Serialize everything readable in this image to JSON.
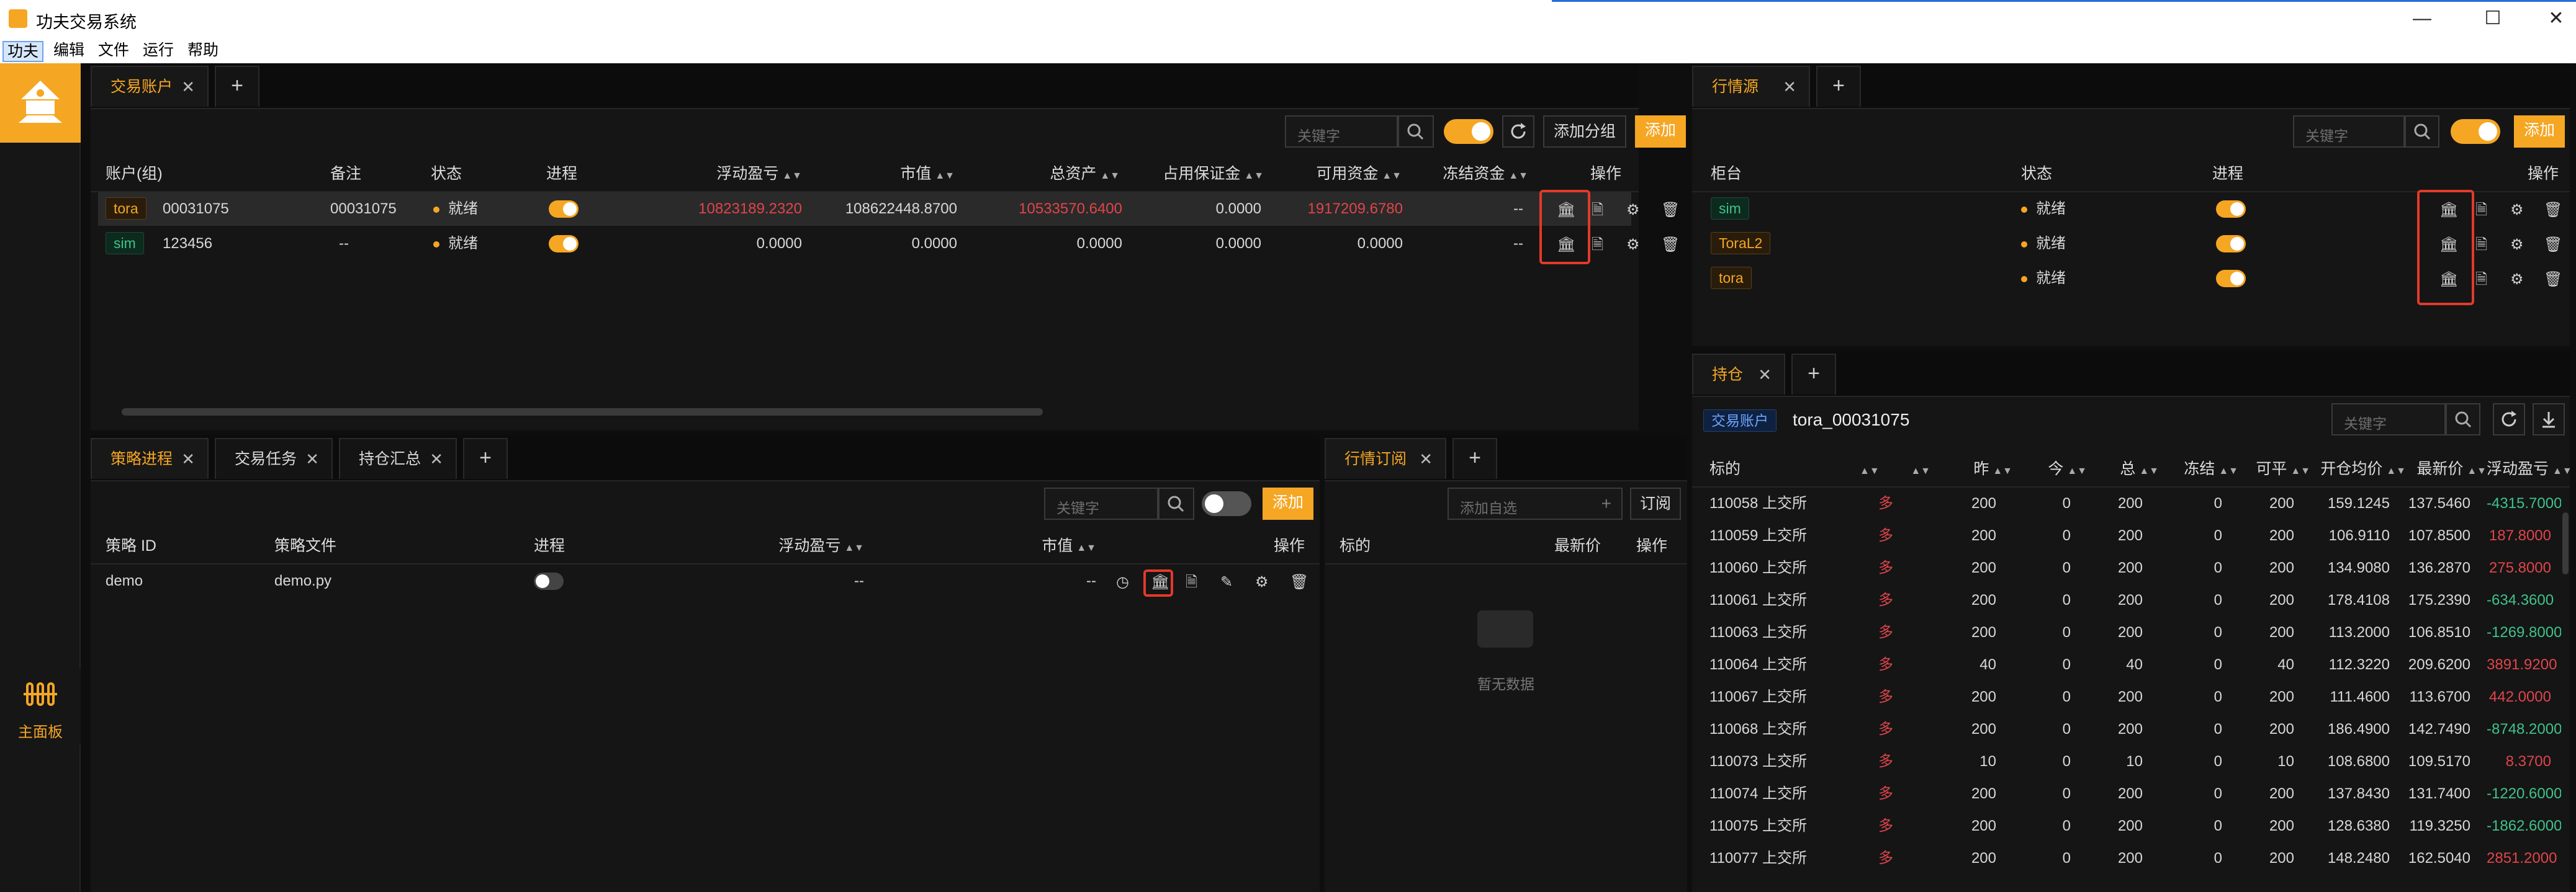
{
  "window": {
    "title": "功夫交易系统",
    "minimize": "—",
    "maximize": "☐",
    "close": "✕"
  },
  "menu": [
    "功夫",
    "编辑",
    "文件",
    "运行",
    "帮助"
  ],
  "sidebar": {
    "main_panel_label": "主面板",
    "main_panel_icon": "0|0|0"
  },
  "accounts_panel": {
    "tabs": [
      {
        "label": "交易账户"
      }
    ],
    "search_placeholder": "关键字",
    "add_group_label": "添加分组",
    "add_label": "添加",
    "columns": [
      "账户(组)",
      "备注",
      "状态",
      "进程",
      "浮动盈亏",
      "市值",
      "总资产",
      "占用保证金",
      "可用资金",
      "冻结资金",
      "操作"
    ],
    "rows": [
      {
        "badge": "tora",
        "account": "00031075",
        "note": "00031075",
        "status": "就绪",
        "pnl": "10823189.2320",
        "market_value": "108622448.8700",
        "total_assets": "10533570.6400",
        "margin": "0.0000",
        "available": "1917209.6780",
        "frozen": "--"
      },
      {
        "badge": "sim",
        "account": "123456",
        "note": "--",
        "status": "就绪",
        "pnl": "0.0000",
        "market_value": "0.0000",
        "total_assets": "0.0000",
        "margin": "0.0000",
        "available": "0.0000",
        "frozen": "--"
      }
    ]
  },
  "md_panel": {
    "tabs": [
      {
        "label": "行情源"
      }
    ],
    "search_placeholder": "关键字",
    "add_label": "添加",
    "columns": [
      "柜台",
      "状态",
      "进程",
      "操作"
    ],
    "rows": [
      {
        "badge": "sim",
        "status": "就绪"
      },
      {
        "badge": "ToraL2",
        "status": "就绪"
      },
      {
        "badge": "tora",
        "status": "就绪"
      }
    ]
  },
  "strategy_panel": {
    "tabs": [
      {
        "label": "策略进程"
      },
      {
        "label": "交易任务"
      },
      {
        "label": "持仓汇总"
      }
    ],
    "search_placeholder": "关键字",
    "add_label": "添加",
    "columns": [
      "策略 ID",
      "策略文件",
      "进程",
      "浮动盈亏",
      "市值",
      "操作"
    ],
    "rows": [
      {
        "id": "demo",
        "file": "demo.py",
        "pnl": "--",
        "market_value": "--"
      }
    ]
  },
  "subscribe_panel": {
    "tabs": [
      {
        "label": "行情订阅"
      }
    ],
    "input_placeholder": "添加自选",
    "subscribe_label": "订阅",
    "columns": [
      "标的",
      "最新价",
      "操作"
    ],
    "empty_text": "暂无数据"
  },
  "position_panel": {
    "tabs": [
      {
        "label": "持仓"
      }
    ],
    "account_tag": "交易账户",
    "account_name": "tora_00031075",
    "search_placeholder": "关键字",
    "columns": [
      "标的",
      "",
      "昨",
      "今",
      "总",
      "冻结",
      "可平",
      "开仓均价",
      "最新价",
      "浮动盈亏"
    ],
    "rows": [
      {
        "code": "110058 上交所",
        "dir": "多",
        "y": "200",
        "t": "0",
        "total": "200",
        "frozen": "0",
        "avail": "200",
        "open": "159.1245",
        "last": "137.5460",
        "pnl": "-4315.7000"
      },
      {
        "code": "110059 上交所",
        "dir": "多",
        "y": "200",
        "t": "0",
        "total": "200",
        "frozen": "0",
        "avail": "200",
        "open": "106.9110",
        "last": "107.8500",
        "pnl": "187.8000"
      },
      {
        "code": "110060 上交所",
        "dir": "多",
        "y": "200",
        "t": "0",
        "total": "200",
        "frozen": "0",
        "avail": "200",
        "open": "134.9080",
        "last": "136.2870",
        "pnl": "275.8000"
      },
      {
        "code": "110061 上交所",
        "dir": "多",
        "y": "200",
        "t": "0",
        "total": "200",
        "frozen": "0",
        "avail": "200",
        "open": "178.4108",
        "last": "175.2390",
        "pnl": "-634.3600"
      },
      {
        "code": "110063 上交所",
        "dir": "多",
        "y": "200",
        "t": "0",
        "total": "200",
        "frozen": "0",
        "avail": "200",
        "open": "113.2000",
        "last": "106.8510",
        "pnl": "-1269.8000"
      },
      {
        "code": "110064 上交所",
        "dir": "多",
        "y": "40",
        "t": "0",
        "total": "40",
        "frozen": "0",
        "avail": "40",
        "open": "112.3220",
        "last": "209.6200",
        "pnl": "3891.9200"
      },
      {
        "code": "110067 上交所",
        "dir": "多",
        "y": "200",
        "t": "0",
        "total": "200",
        "frozen": "0",
        "avail": "200",
        "open": "111.4600",
        "last": "113.6700",
        "pnl": "442.0000"
      },
      {
        "code": "110068 上交所",
        "dir": "多",
        "y": "200",
        "t": "0",
        "total": "200",
        "frozen": "0",
        "avail": "200",
        "open": "186.4900",
        "last": "142.7490",
        "pnl": "-8748.2000"
      },
      {
        "code": "110073 上交所",
        "dir": "多",
        "y": "10",
        "t": "0",
        "total": "10",
        "frozen": "0",
        "avail": "10",
        "open": "108.6800",
        "last": "109.5170",
        "pnl": "8.3700"
      },
      {
        "code": "110074 上交所",
        "dir": "多",
        "y": "200",
        "t": "0",
        "total": "200",
        "frozen": "0",
        "avail": "200",
        "open": "137.8430",
        "last": "131.7400",
        "pnl": "-1220.6000"
      },
      {
        "code": "110075 上交所",
        "dir": "多",
        "y": "200",
        "t": "0",
        "total": "200",
        "frozen": "0",
        "avail": "200",
        "open": "128.6380",
        "last": "119.3250",
        "pnl": "-1862.6000"
      },
      {
        "code": "110077 上交所",
        "dir": "多",
        "y": "200",
        "t": "0",
        "total": "200",
        "frozen": "0",
        "avail": "200",
        "open": "148.2480",
        "last": "162.5040",
        "pnl": "2851.2000"
      }
    ]
  },
  "colors": {
    "accent": "#f5a623",
    "up": "#e0454a",
    "down": "#3fc28b",
    "highlight": "#e23a2a"
  },
  "icons": {
    "account_row_actions": [
      "bank-icon",
      "file-icon",
      "gear-icon",
      "trash-icon"
    ],
    "strategy_row_actions": [
      "history-icon",
      "bank-icon",
      "file-icon",
      "edit-icon",
      "gear-icon",
      "trash-icon"
    ]
  }
}
